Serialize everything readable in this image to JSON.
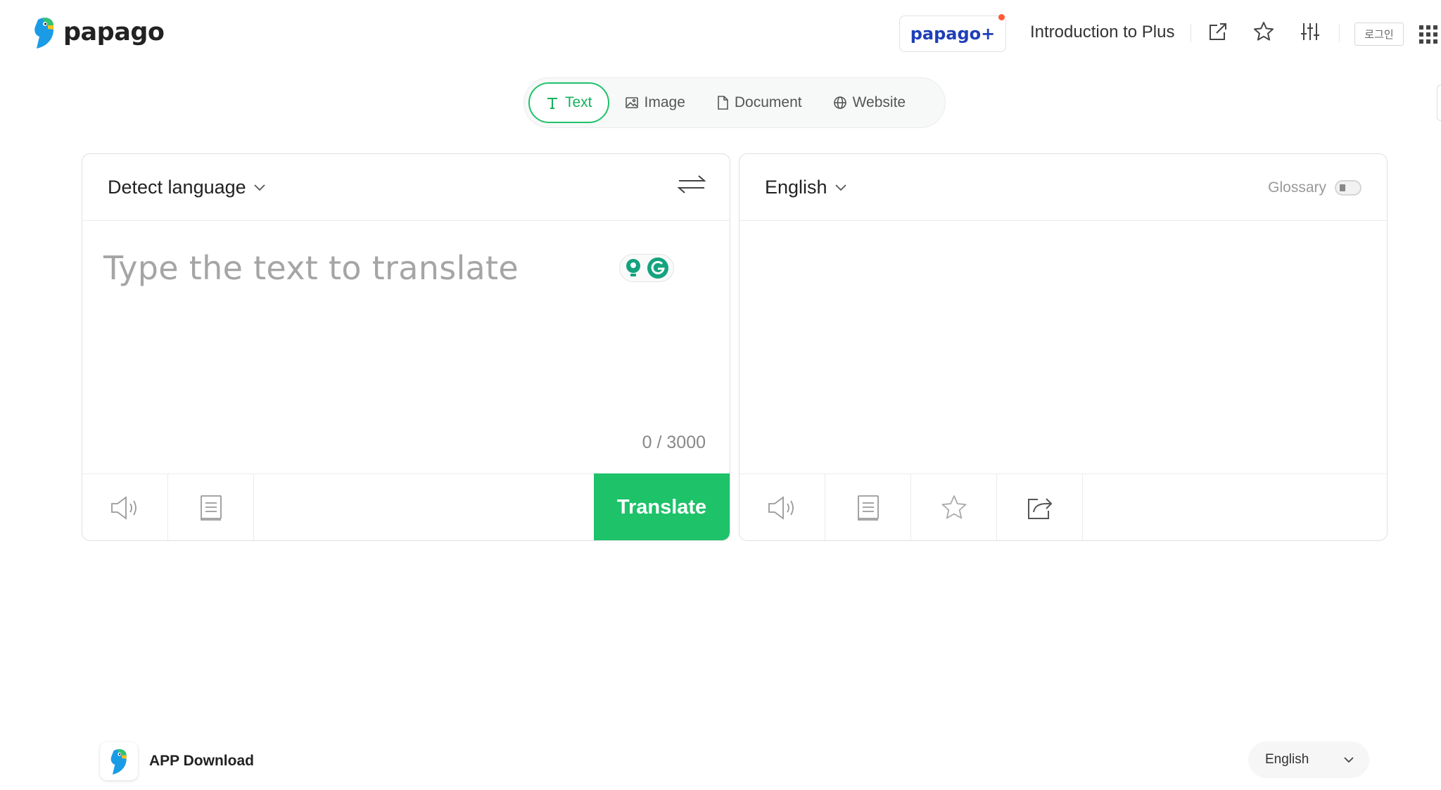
{
  "header": {
    "logo_text": "papago",
    "plus_badge": "papago+",
    "intro_link": "Introduction to Plus",
    "login_label": "로그인",
    "icons": [
      "external-link-icon",
      "star-icon",
      "settings-sliders-icon",
      "apps-grid-icon"
    ]
  },
  "tabs": [
    {
      "label": "Text",
      "icon": "text-icon",
      "active": true
    },
    {
      "label": "Image",
      "icon": "image-icon",
      "active": false
    },
    {
      "label": "Document",
      "icon": "document-icon",
      "active": false
    },
    {
      "label": "Website",
      "icon": "globe-icon",
      "active": false
    }
  ],
  "source": {
    "language": "Detect language",
    "placeholder": "Type the text to translate",
    "char_count": "0 / 3000",
    "translate_label": "Translate"
  },
  "target": {
    "language": "English",
    "glossary_label": "Glossary"
  },
  "footer": {
    "app_download": "APP Download",
    "language": "English"
  },
  "colors": {
    "accent": "#1dc269",
    "plus_blue": "#1f3fb8",
    "notify_dot": "#ff5a36"
  }
}
